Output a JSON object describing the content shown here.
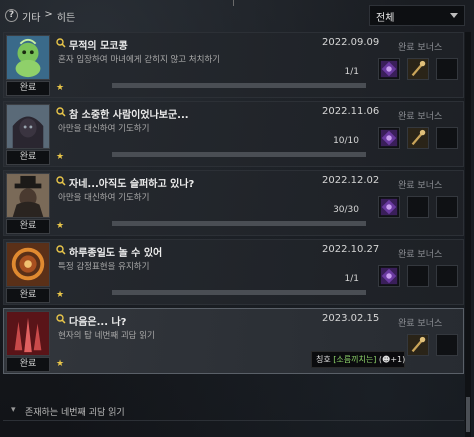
{
  "header": {
    "help_icon": "?",
    "breadcrumb": [
      "기타",
      ">",
      "히든"
    ],
    "filter_selected": "전체"
  },
  "quests": [
    {
      "title": "무적의 모코콩",
      "date": "2022.09.09",
      "description": "혼자 입장하여 마녀에게 갇히지 않고 처치하기",
      "progress": "1/1",
      "status": "완료",
      "bonus_label": "완료 보너스",
      "thumb": "green-mokoko",
      "slots": [
        "purple-card",
        "brass-key",
        ""
      ]
    },
    {
      "title": "참 소중한 사람이었나보군...",
      "date": "2022.11.06",
      "description": "아만을 대신하여 기도하기",
      "progress": "10/10",
      "status": "완료",
      "bonus_label": "완료 보너스",
      "thumb": "hooded-figure",
      "slots": [
        "purple-card",
        "brass-key",
        ""
      ]
    },
    {
      "title": "자네...아직도 슬퍼하고 있나?",
      "date": "2022.12.02",
      "description": "아만을 대신하여 기도하기",
      "progress": "30/30",
      "status": "완료",
      "bonus_label": "완료 보너스",
      "thumb": "hat-figure",
      "slots": [
        "purple-card",
        "",
        ""
      ]
    },
    {
      "title": "하루종일도 놀 수 있어",
      "date": "2022.10.27",
      "description": "특정 감정표현을 유지하기",
      "progress": "1/1",
      "status": "완료",
      "bonus_label": "완료 보너스",
      "thumb": "fire-ring",
      "slots": [
        "purple-card",
        "",
        ""
      ]
    },
    {
      "title": "다음은... 나?",
      "date": "2023.02.15",
      "description": "현자의 탑 네번째 괴담 읽기",
      "progress": "",
      "status": "완료",
      "bonus_label": "완료 보너스",
      "thumb": "red-hands",
      "slots": [
        "",
        "brass-key",
        ""
      ],
      "tooltip": {
        "prefix": "칭호",
        "highlight": "[소름끼치는]",
        "suffix": "(☻+1)"
      }
    }
  ],
  "footer": {
    "chevron": "▾",
    "label": "존재하는 네번째 괴담 읽기"
  },
  "colors": {
    "accent_yellow": "#e9c64a",
    "highlight_green": "#8fd66a",
    "purple_card": "#6a3aa0"
  }
}
